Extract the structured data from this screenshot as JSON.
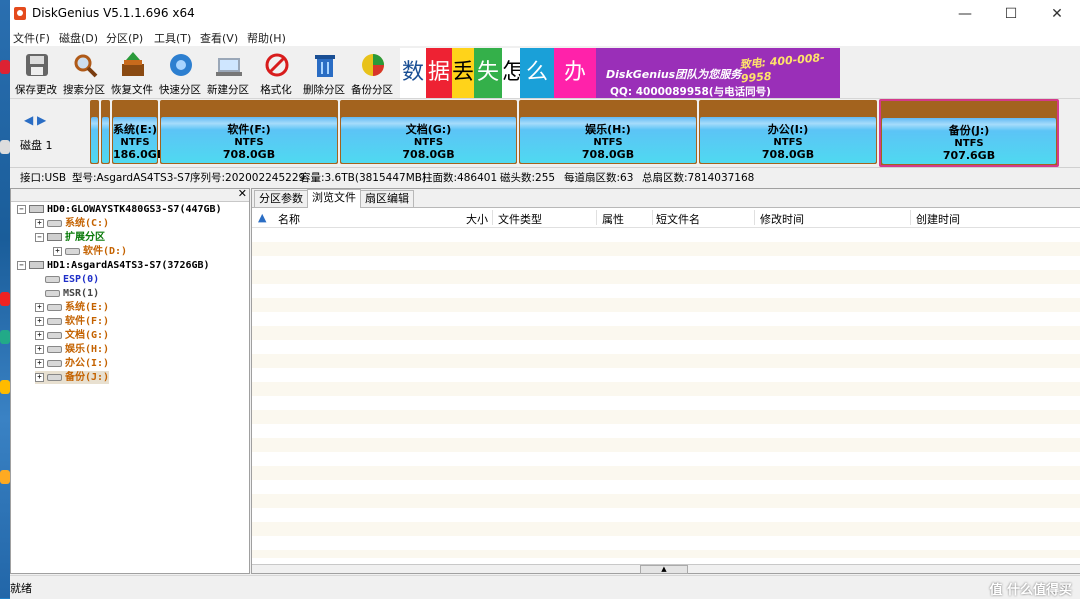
{
  "window": {
    "title": "DiskGenius V5.1.1.696 x64"
  },
  "window_controls": {
    "minimize": "—",
    "maximize": "☐",
    "close": "✕"
  },
  "menu": [
    "文件(F)",
    "磁盘(D)",
    "分区(P)",
    "工具(T)",
    "查看(V)",
    "帮助(H)"
  ],
  "toolbar": [
    {
      "label": "保存更改",
      "icon": "save-icon"
    },
    {
      "label": "搜索分区",
      "icon": "search-icon"
    },
    {
      "label": "恢复文件",
      "icon": "recover-icon"
    },
    {
      "label": "快速分区",
      "icon": "quick-partition-icon"
    },
    {
      "label": "新建分区",
      "icon": "new-partition-icon"
    },
    {
      "label": "格式化",
      "icon": "format-icon"
    },
    {
      "label": "删除分区",
      "icon": "delete-icon"
    },
    {
      "label": "备份分区",
      "icon": "backup-icon"
    }
  ],
  "banner": {
    "chars": [
      "数",
      "据",
      "丢",
      "失",
      "怎",
      "么",
      "办"
    ],
    "title": "DiskGenius团队为您服务",
    "phone": "致电: 400-008-9958",
    "qq": "QQ: 4000089958(与电话同号)"
  },
  "disk_map": {
    "disk_label": "磁盘 1",
    "partitions": [
      {
        "name": "系统(E:)",
        "fs": "NTFS",
        "size": "186.0GB"
      },
      {
        "name": "软件(F:)",
        "fs": "NTFS",
        "size": "708.0GB"
      },
      {
        "name": "文档(G:)",
        "fs": "NTFS",
        "size": "708.0GB"
      },
      {
        "name": "娱乐(H:)",
        "fs": "NTFS",
        "size": "708.0GB"
      },
      {
        "name": "办公(I:)",
        "fs": "NTFS",
        "size": "708.0GB"
      },
      {
        "name": "备份(J:)",
        "fs": "NTFS",
        "size": "707.6GB"
      }
    ]
  },
  "info": {
    "interface": "接口:USB",
    "model": "型号:AsgardAS4TS3-S7",
    "serial": "序列号:202002245229",
    "capacity": "容量:3.6TB(3815447MB)",
    "cylinders": "柱面数:486401",
    "heads": "磁头数:255",
    "sectors_per_track": "每道扇区数:63",
    "total_sectors": "总扇区数:7814037168"
  },
  "tree": {
    "hd0": "HD0:GLOWAYSTK480GS3-S7(447GB)",
    "hd0_children": [
      "系统(C:)",
      "扩展分区",
      "软件(D:)"
    ],
    "hd1": "HD1:AsgardAS4TS3-S7(3726GB)",
    "hd1_children": [
      "ESP(0)",
      "MSR(1)",
      "系统(E:)",
      "软件(F:)",
      "文档(G:)",
      "娱乐(H:)",
      "办公(I:)",
      "备份(J:)"
    ]
  },
  "tabs": [
    "分区参数",
    "浏览文件",
    "扇区编辑"
  ],
  "columns": [
    "名称",
    "大小",
    "文件类型",
    "属性",
    "短文件名",
    "修改时间",
    "创建时间"
  ],
  "status": "就绪",
  "watermark": "值 什么值得买"
}
